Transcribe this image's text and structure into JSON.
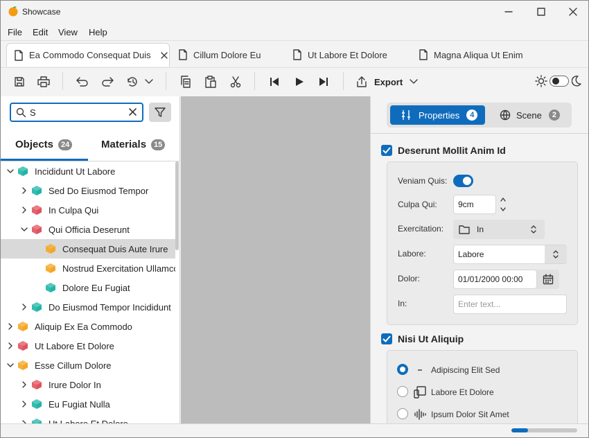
{
  "window": {
    "title": "Showcase"
  },
  "menu": [
    "File",
    "Edit",
    "View",
    "Help"
  ],
  "tabs": [
    {
      "label": "Ea Commodo Consequat Duis",
      "active": true
    },
    {
      "label": "Cillum Dolore Eu",
      "active": false
    },
    {
      "label": "Ut Labore Et Dolore",
      "active": false
    },
    {
      "label": "Magna Aliqua Ut Enim",
      "active": false
    }
  ],
  "toolbar": {
    "export_label": "Export"
  },
  "search": {
    "value": "S",
    "placeholder": ""
  },
  "panel_tabs": [
    {
      "label": "Objects",
      "count": "24",
      "active": true
    },
    {
      "label": "Materials",
      "count": "15",
      "active": false
    }
  ],
  "tree": [
    {
      "label": "Incididunt Ut Labore",
      "level": 0,
      "expanded": true,
      "color": "teal"
    },
    {
      "label": "Sed Do Eiusmod Tempor",
      "level": 1,
      "expanded": false,
      "color": "teal"
    },
    {
      "label": "In Culpa Qui",
      "level": 1,
      "expanded": false,
      "color": "red"
    },
    {
      "label": "Qui Officia Deserunt",
      "level": 1,
      "expanded": true,
      "color": "red"
    },
    {
      "label": "Consequat Duis Aute Irure",
      "level": 2,
      "leaf": true,
      "color": "orange",
      "selected": true
    },
    {
      "label": "Nostrud Exercitation Ullamco",
      "level": 2,
      "leaf": true,
      "color": "orange"
    },
    {
      "label": "Dolore Eu Fugiat",
      "level": 2,
      "leaf": true,
      "color": "teal"
    },
    {
      "label": "Do Eiusmod Tempor Incididunt",
      "level": 1,
      "expanded": false,
      "color": "teal"
    },
    {
      "label": "Aliquip Ex Ea Commodo",
      "level": 0,
      "expanded": false,
      "color": "orange"
    },
    {
      "label": "Ut Labore Et Dolore",
      "level": 0,
      "expanded": false,
      "color": "red"
    },
    {
      "label": "Esse Cillum Dolore",
      "level": 0,
      "expanded": true,
      "color": "orange"
    },
    {
      "label": "Irure Dolor In",
      "level": 1,
      "expanded": false,
      "color": "red"
    },
    {
      "label": "Eu Fugiat Nulla",
      "level": 1,
      "expanded": false,
      "color": "teal"
    },
    {
      "label": "Ut Labore Et Dolore",
      "level": 1,
      "expanded": false,
      "color": "teal"
    }
  ],
  "cube_colors": {
    "teal": "#1fb5a6",
    "red": "#e0525e",
    "orange": "#f5a623"
  },
  "right": {
    "segments": [
      {
        "label": "Properties",
        "count": "4",
        "active": true
      },
      {
        "label": "Scene",
        "count": "2",
        "active": false
      }
    ],
    "section1": {
      "title": "Deserunt Mollit Anim Id",
      "checked": true,
      "fields": {
        "toggle_label": "Veniam Quis:",
        "toggle_on": true,
        "spin_label": "Culpa Qui:",
        "spin_value": "9cm",
        "folder_label": "Exercitation:",
        "folder_value": "In",
        "combo_label": "Labore:",
        "combo_value": "Labore",
        "date_label": "Dolor:",
        "date_value": "01/01/2000 00:00",
        "text_label": "In:",
        "text_placeholder": "Enter text..."
      }
    },
    "section2": {
      "title": "Nisi Ut Aliquip",
      "checked": true,
      "options": [
        {
          "label": "Adipiscing Elit Sed",
          "icon": "dash-icon",
          "selected": true
        },
        {
          "label": "Labore Et Dolore",
          "icon": "device-icon",
          "selected": false
        },
        {
          "label": "Ipsum Dolor Sit Amet",
          "icon": "waveform-icon",
          "selected": false
        }
      ]
    }
  },
  "status": {
    "progress": 0.25
  },
  "accent": "#0f6cbd"
}
